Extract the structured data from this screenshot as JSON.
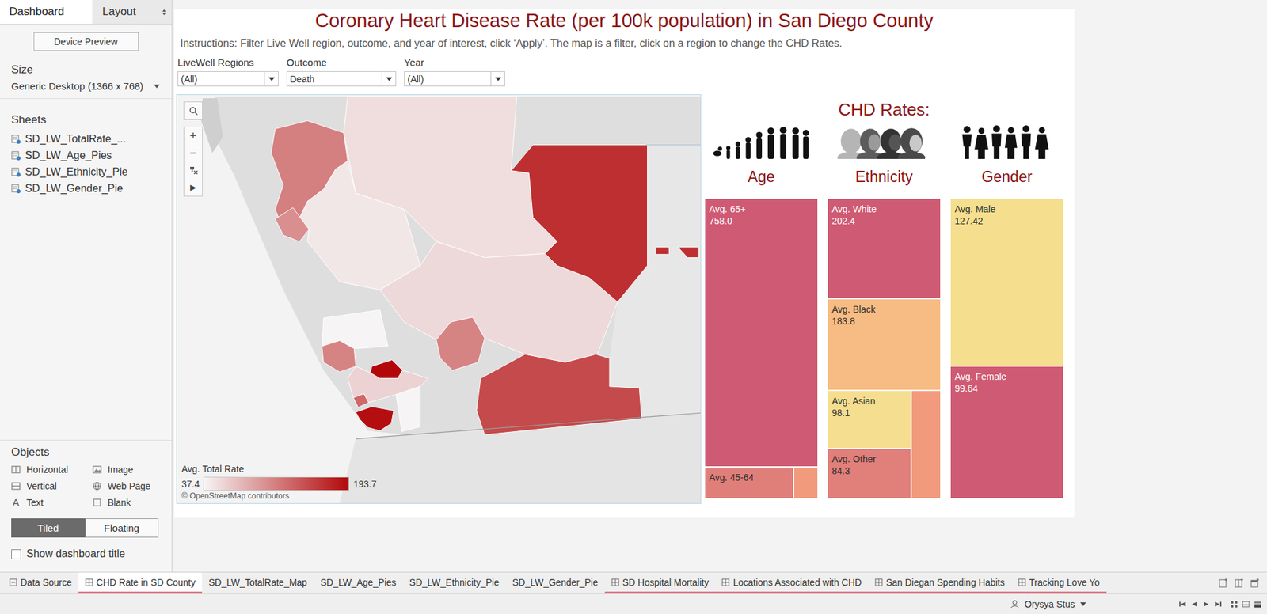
{
  "side_tabs": [
    {
      "label": "Dashboard",
      "selected": true,
      "menu": false
    },
    {
      "label": "Layout",
      "selected": false,
      "menu": true
    }
  ],
  "device_preview": "Device Preview",
  "size": {
    "title": "Size",
    "value": "Generic Desktop (1366 x 768)"
  },
  "sheets": {
    "title": "Sheets",
    "items": [
      "SD_LW_TotalRate_...",
      "SD_LW_Age_Pies",
      "SD_LW_Ethnicity_Pie",
      "SD_LW_Gender_Pie"
    ]
  },
  "objects": {
    "title": "Objects",
    "items": [
      {
        "label": "Horizontal",
        "kind": "horizontal"
      },
      {
        "label": "Image",
        "kind": "image"
      },
      {
        "label": "Vertical",
        "kind": "vertical"
      },
      {
        "label": "Web Page",
        "kind": "web"
      },
      {
        "label": "Text",
        "kind": "text",
        "glyph": "A"
      },
      {
        "label": "Blank",
        "kind": "blank"
      }
    ]
  },
  "mode": [
    {
      "label": "Tiled",
      "selected": true
    },
    {
      "label": "Floating",
      "selected": false
    }
  ],
  "show_title": {
    "label": "Show dashboard title",
    "checked": false
  },
  "dashboard": {
    "title": "Coronary Heart Disease Rate (per 100k population) in San Diego County",
    "instructions": "Instructions: Filter Live Well region, outcome, and year of interest, click ‘Apply’. The map is a filter, click on a region to change the CHD Rates.",
    "filters": [
      {
        "label": "LiveWell Regions",
        "value": "(All)"
      },
      {
        "label": "Outcome",
        "value": "Death"
      },
      {
        "label": "Year",
        "value": "(All)"
      }
    ]
  },
  "map": {
    "zoom_in": "+",
    "zoom_out": "−",
    "expand": "▶",
    "legend": {
      "title": "Avg. Total Rate",
      "min": "37.4",
      "max": "193.7"
    },
    "attribution": "© OpenStreetMap contributors",
    "regions": [
      {
        "rate": 52
      },
      {
        "rate": 46
      },
      {
        "rate": 55
      },
      {
        "rate": 37.4
      },
      {
        "rate": 60
      },
      {
        "rate": 37.4
      },
      {
        "rate": 168
      },
      {
        "rate": 168
      },
      {
        "rate": 168
      },
      {
        "rate": 115
      },
      {
        "rate": 105
      },
      {
        "rate": 150
      },
      {
        "rate": 112
      },
      {
        "rate": 193.7
      },
      {
        "rate": 190
      },
      {
        "rate": 112
      },
      {
        "rate": 130
      }
    ]
  },
  "rates": {
    "title": "CHD Rates:",
    "panels": [
      {
        "title": "Age",
        "cells": [
          {
            "label": "Avg. 65+",
            "reading": "758.0",
            "value": 758.0,
            "color": "#cf5a73"
          },
          {
            "label": "Avg. 45-64",
            "reading": "",
            "value": 73.0,
            "color": "#e07f7a"
          },
          {
            "label": "",
            "reading": "",
            "value": 13.7,
            "color": "#f29a7c"
          }
        ]
      },
      {
        "title": "Ethnicity",
        "cells": [
          {
            "label": "Avg. White",
            "reading": "202.4",
            "value": 202.4,
            "color": "#cf5a73"
          },
          {
            "label": "Avg. Black",
            "reading": "183.8",
            "value": 183.8,
            "color": "#f7bc83"
          },
          {
            "label": "Avg. Asian",
            "reading": "98.1",
            "value": 98.1,
            "color": "#f5de8f"
          },
          {
            "label": "Avg. Other",
            "reading": "84.3",
            "value": 84.3,
            "color": "#e17f7a"
          },
          {
            "label": "",
            "reading": "",
            "value": 44.6,
            "color": "#f29a7c"
          }
        ]
      },
      {
        "title": "Gender",
        "cells": [
          {
            "label": "Avg. Male",
            "reading": "127.42",
            "value": 127.42,
            "color": "#f5df8f"
          },
          {
            "label": "Avg. Female",
            "reading": "99.64",
            "value": 99.64,
            "color": "#cf5a73"
          }
        ]
      }
    ]
  },
  "bottom_tabs": [
    {
      "label": "Data Source",
      "kind": "source",
      "selected": false
    },
    {
      "label": "CHD Rate in SD County",
      "kind": "dashboard",
      "selected": true
    },
    {
      "label": "SD_LW_TotalRate_Map",
      "kind": "worksheet",
      "selected": false
    },
    {
      "label": "SD_LW_Age_Pies",
      "kind": "worksheet",
      "selected": false
    },
    {
      "label": "SD_LW_Ethnicity_Pie",
      "kind": "worksheet",
      "selected": false
    },
    {
      "label": "SD_LW_Gender_Pie",
      "kind": "worksheet",
      "selected": false
    },
    {
      "label": "SD Hospital Mortality",
      "kind": "dashboard",
      "selected": false
    },
    {
      "label": "Locations Associated with CHD",
      "kind": "dashboard",
      "selected": false
    },
    {
      "label": "San Diegan Spending Habits",
      "kind": "dashboard",
      "selected": false
    },
    {
      "label": "Tracking Love Yo",
      "kind": "dashboard",
      "selected": false
    }
  ],
  "status": {
    "user": "Orysya Stus"
  }
}
